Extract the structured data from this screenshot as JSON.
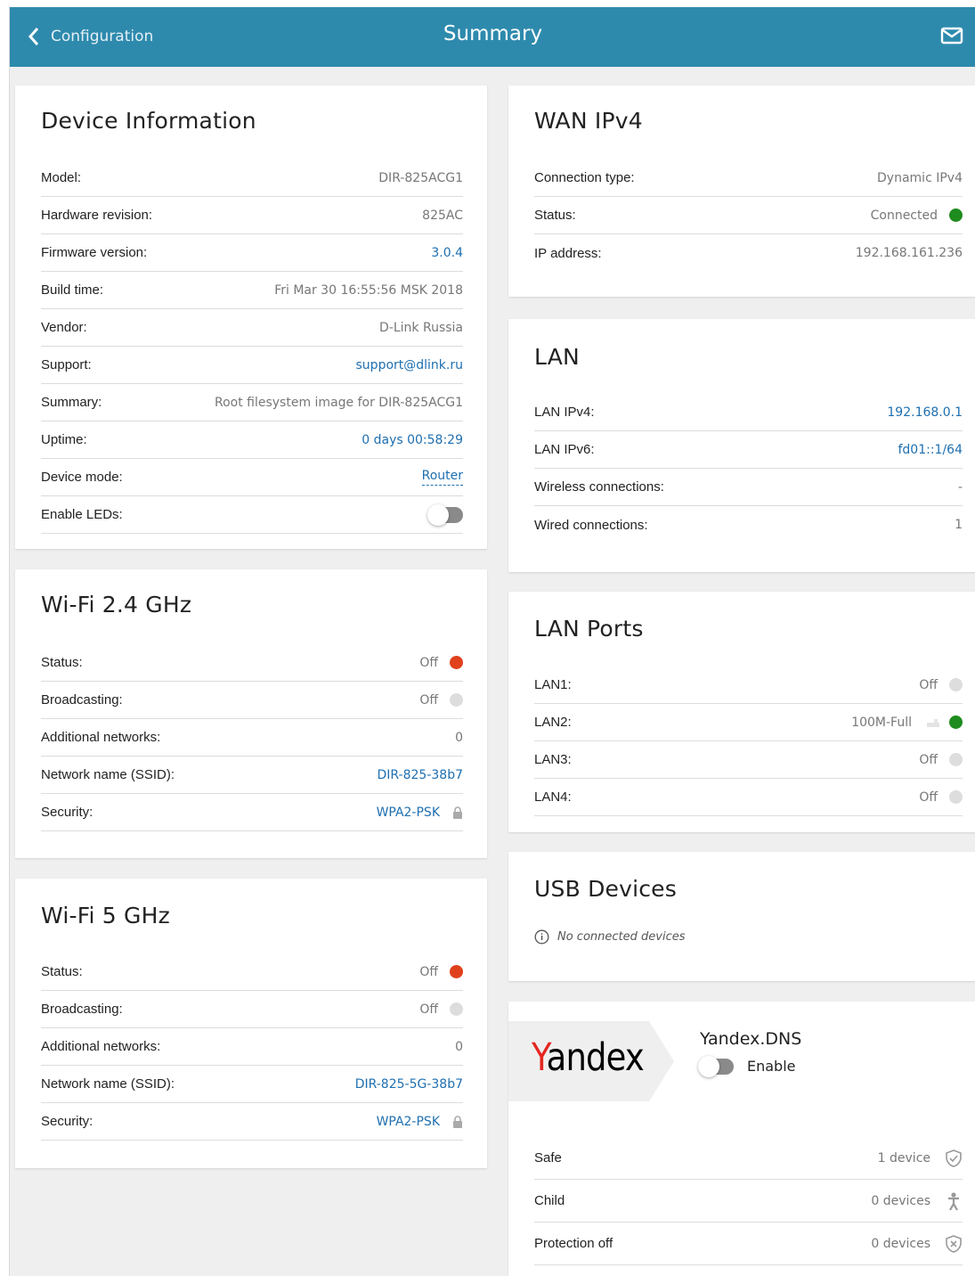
{
  "header": {
    "back_label": "Configuration",
    "title": "Summary",
    "colors": {
      "bar": "#2e8aad"
    }
  },
  "device_info": {
    "title": "Device Information",
    "rows": [
      {
        "label": "Model:",
        "value": "DIR-825ACG1"
      },
      {
        "label": "Hardware revision:",
        "value": "825AC"
      },
      {
        "label": "Firmware version:",
        "value": "3.0.4"
      },
      {
        "label": "Build time:",
        "value": "Fri Mar 30 16:55:56 MSK 2018"
      },
      {
        "label": "Vendor:",
        "value": "D-Link Russia"
      },
      {
        "label": "Support:",
        "value": "support@dlink.ru"
      },
      {
        "label": "Summary:",
        "value": "Root filesystem image for DIR-825ACG1"
      },
      {
        "label": "Uptime:",
        "value": "0 days 00:58:29"
      },
      {
        "label": "Device mode:",
        "value": "Router"
      },
      {
        "label": "Enable LEDs:",
        "value": ""
      }
    ],
    "leds_enabled": false
  },
  "wifi24": {
    "title": "Wi-Fi 2.4 GHz",
    "rows": [
      {
        "label": "Status:",
        "value": "Off"
      },
      {
        "label": "Broadcasting:",
        "value": "Off"
      },
      {
        "label": "Additional networks:",
        "value": "0"
      },
      {
        "label": "Network name (SSID):",
        "value": "DIR-825-38b7"
      },
      {
        "label": "Security:",
        "value": "WPA2-PSK"
      }
    ]
  },
  "wifi5": {
    "title": "Wi-Fi 5 GHz",
    "rows": [
      {
        "label": "Status:",
        "value": "Off"
      },
      {
        "label": "Broadcasting:",
        "value": "Off"
      },
      {
        "label": "Additional networks:",
        "value": "0"
      },
      {
        "label": "Network name (SSID):",
        "value": "DIR-825-5G-38b7"
      },
      {
        "label": "Security:",
        "value": "WPA2-PSK"
      }
    ]
  },
  "wan": {
    "title": "WAN IPv4",
    "rows": [
      {
        "label": "Connection type:",
        "value": "Dynamic IPv4"
      },
      {
        "label": "Status:",
        "value": "Connected"
      },
      {
        "label": "IP address:",
        "value": "192.168.161.236"
      }
    ]
  },
  "lan": {
    "title": "LAN",
    "rows": [
      {
        "label": "LAN IPv4:",
        "value": "192.168.0.1"
      },
      {
        "label": "LAN IPv6:",
        "value": "fd01::1/64"
      },
      {
        "label": "Wireless connections:",
        "value": "-"
      },
      {
        "label": "Wired connections:",
        "value": "1"
      }
    ]
  },
  "lan_ports": {
    "title": "LAN Ports",
    "rows": [
      {
        "label": "LAN1:",
        "value": "Off"
      },
      {
        "label": "LAN2:",
        "value": "100M-Full"
      },
      {
        "label": "LAN3:",
        "value": "Off"
      },
      {
        "label": "LAN4:",
        "value": "Off"
      }
    ]
  },
  "usb": {
    "title": "USB Devices",
    "message": "No connected devices"
  },
  "yandex": {
    "logo_text": "Yandex",
    "title": "Yandex.DNS",
    "enable_label": "Enable",
    "enabled": false,
    "rows": [
      {
        "label": "Safe",
        "value": "1 device",
        "icon": "shield-check-icon"
      },
      {
        "label": "Child",
        "value": "0 devices",
        "icon": "child-icon"
      },
      {
        "label": "Protection off",
        "value": "0 devices",
        "icon": "shield-x-icon"
      }
    ]
  },
  "status_colors": {
    "on": "#1e8c1e",
    "off_red": "#e0401c",
    "off_grey": "#dddddd",
    "link": "#1e6fb0"
  }
}
